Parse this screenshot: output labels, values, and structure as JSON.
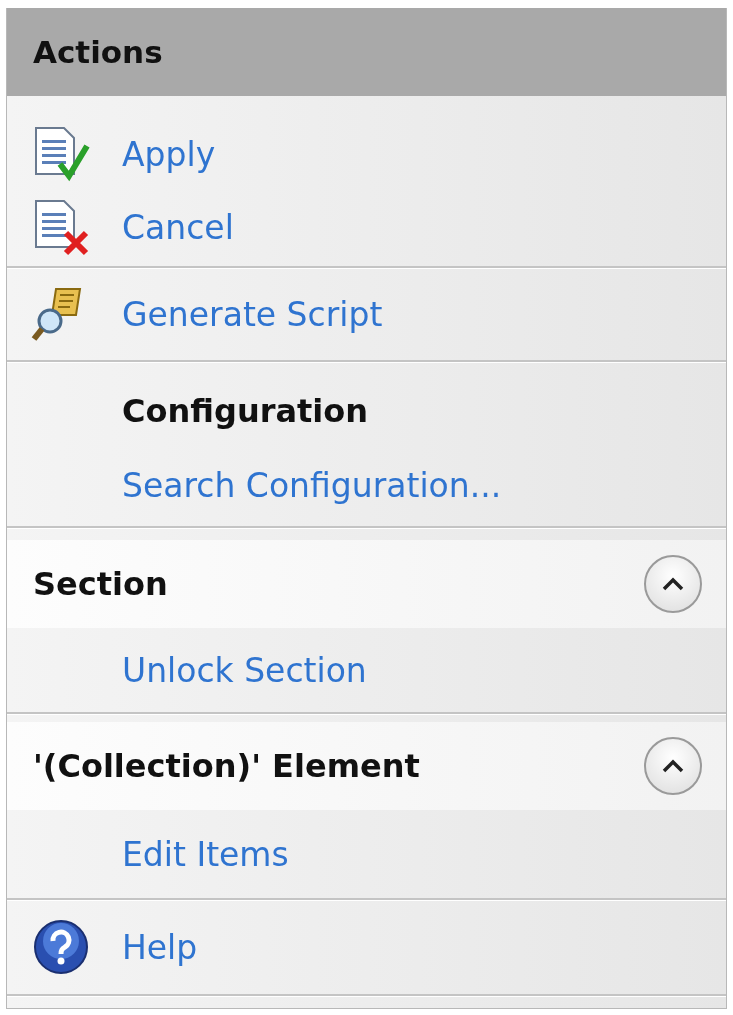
{
  "panel": {
    "title": "Actions"
  },
  "groups": [
    {
      "kind": "plain",
      "items": [
        {
          "label": "Apply",
          "kind": "apply"
        },
        {
          "label": "Cancel",
          "kind": "cancel"
        }
      ]
    },
    {
      "kind": "plain",
      "items": [
        {
          "label": "Generate Script",
          "kind": "script"
        }
      ]
    },
    {
      "kind": "titled",
      "heading": "Configuration",
      "items": [
        {
          "label": "Search Configuration...",
          "kind": "plain"
        }
      ]
    },
    {
      "kind": "collapsible",
      "heading": "Section",
      "expanded": true,
      "items": [
        {
          "label": "Unlock Section",
          "kind": "plain"
        }
      ]
    },
    {
      "kind": "collapsible",
      "heading": "'(Collection)' Element",
      "expanded": true,
      "items": [
        {
          "label": "Edit Items",
          "kind": "plain"
        }
      ]
    },
    {
      "kind": "plain",
      "items": [
        {
          "label": "Help",
          "kind": "help"
        }
      ]
    }
  ]
}
